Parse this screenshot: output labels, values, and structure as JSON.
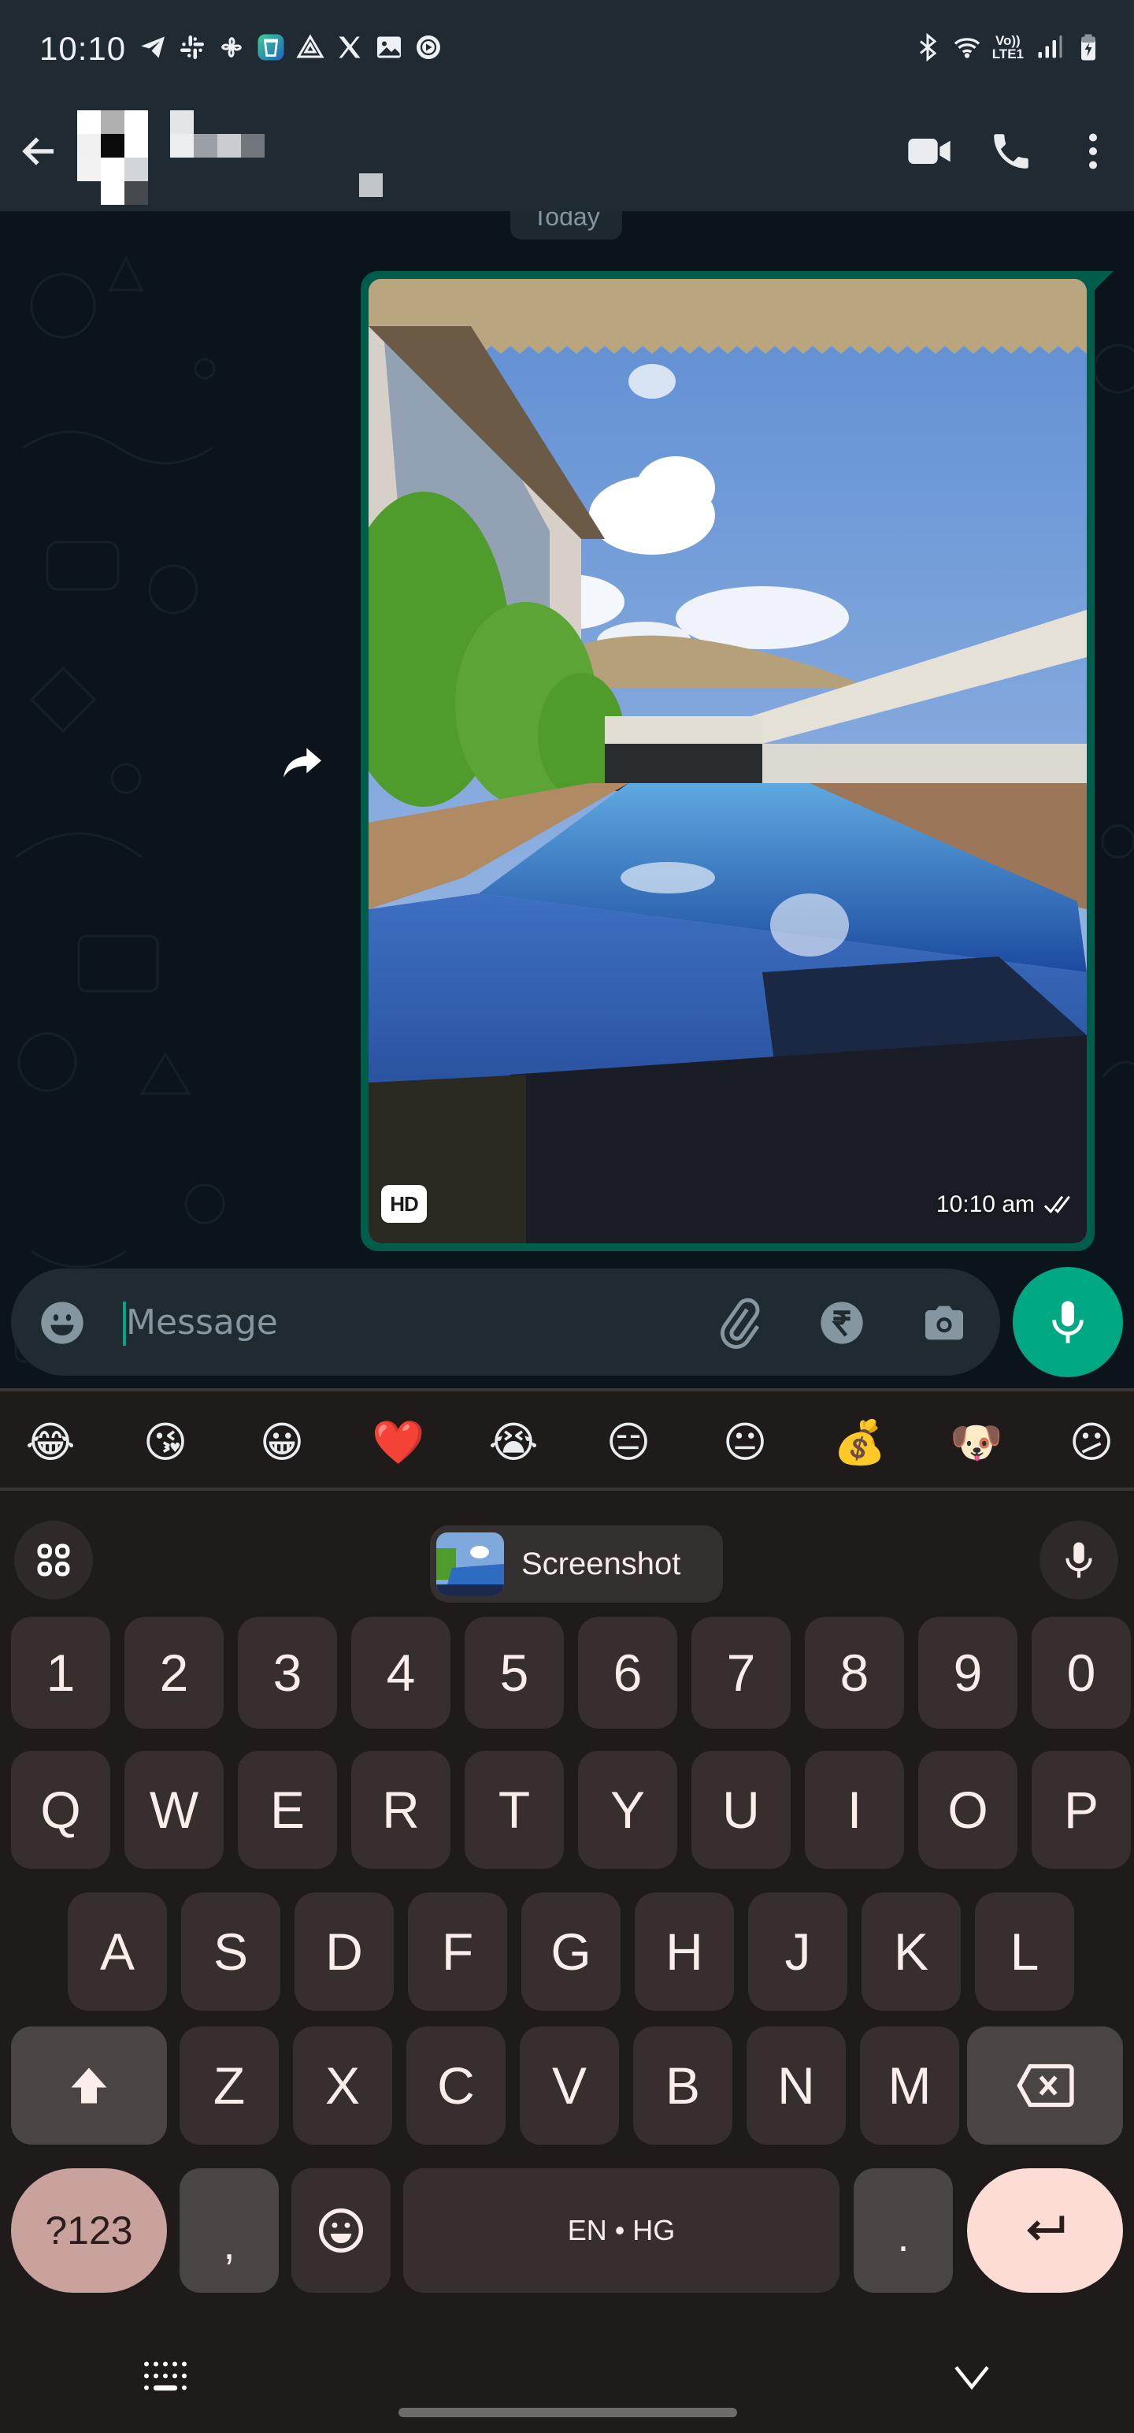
{
  "status_bar": {
    "time": "10:10",
    "left_icons": [
      "telegram-icon",
      "slack-icon",
      "pinwheel-icon",
      "app-cup-icon",
      "drive-icon",
      "x-icon",
      "gallery-icon",
      "youtube-music-icon"
    ],
    "right_icons": [
      "bluetooth-icon",
      "wifi-icon",
      "volte-icon",
      "signal-icon",
      "battery-charging-icon"
    ],
    "volte_top": "Vo))",
    "volte_bottom": "LTE1"
  },
  "app_bar": {
    "contact_name": "",
    "actions": [
      "video-call",
      "voice-call",
      "more-options"
    ]
  },
  "chat": {
    "date_chip": "Today",
    "message": {
      "type": "image",
      "hd_badge": "HD",
      "time": "10:10 am",
      "status": "read",
      "status_icon": "double-check-icon"
    }
  },
  "composer": {
    "placeholder": "Message",
    "value": ""
  },
  "keyboard": {
    "emoji_suggestions": [
      "😂",
      "😘",
      "😀",
      "❤️",
      "😭",
      "😑",
      "😐",
      "💰",
      "🐶",
      "😕"
    ],
    "suggestion_chip": "Screenshot",
    "rows": [
      [
        "1",
        "2",
        "3",
        "4",
        "5",
        "6",
        "7",
        "8",
        "9",
        "0"
      ],
      [
        "Q",
        "W",
        "E",
        "R",
        "T",
        "Y",
        "U",
        "I",
        "O",
        "P"
      ],
      [
        "A",
        "S",
        "D",
        "F",
        "G",
        "H",
        "J",
        "K",
        "L"
      ],
      [
        "Z",
        "X",
        "C",
        "V",
        "B",
        "N",
        "M"
      ]
    ],
    "symbols_key": "?123",
    "comma_key": ",",
    "period_key": ".",
    "space_label": "EN • HG"
  },
  "colors": {
    "accent": "#00a884",
    "bubble_out": "#005c4b",
    "appbar": "#1f2a33",
    "chat_bg": "#0b141a",
    "keyboard_bg": "#1f1b1a",
    "key": "#362f2e",
    "symbols_key": "#c9a29d",
    "enter_key": "#fcdcd4"
  }
}
